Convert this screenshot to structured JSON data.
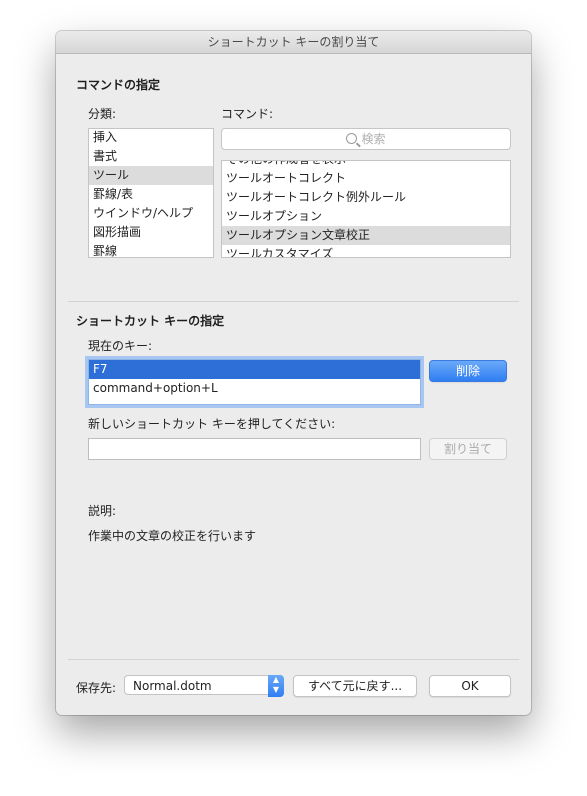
{
  "window": {
    "title": "ショートカット キーの割り当て"
  },
  "command_section": {
    "title": "コマンドの指定",
    "categories_label": "分類:",
    "commands_label": "コマンド:",
    "search_placeholder": "検索",
    "categories": [
      "挿入",
      "書式",
      "ツール",
      "罫線/表",
      "ウインドウ/ヘルプ",
      "図形描画",
      "罫線"
    ],
    "selected_category": "ツール",
    "commands": [
      "その他の作成者を表示",
      "ツールオートコレクト",
      "ツールオートコレクト例外ルール",
      "ツールオプション",
      "ツールオプション文章校正",
      "ツールカスタマイズ"
    ],
    "selected_command": "ツールオプション文章校正"
  },
  "shortcut_section": {
    "title": "ショートカット キーの指定",
    "current_keys_label": "現在のキー:",
    "current_keys": [
      "F7",
      "command+option+L"
    ],
    "delete_button": "削除",
    "new_key_label": "新しいショートカット キーを押してください:",
    "new_key_value": "",
    "assign_button": "割り当て"
  },
  "description": {
    "label": "説明:",
    "text": "作業中の文章の校正を行います"
  },
  "footer": {
    "save_in_label": "保存先:",
    "save_in_value": "Normal.dotm",
    "reset_button": "すべて元に戻す...",
    "ok_button": "OK"
  },
  "colors": {
    "accent": "#2f7ef2",
    "selection": "#2d6fd6",
    "list_highlight": "#dcdcdc"
  }
}
